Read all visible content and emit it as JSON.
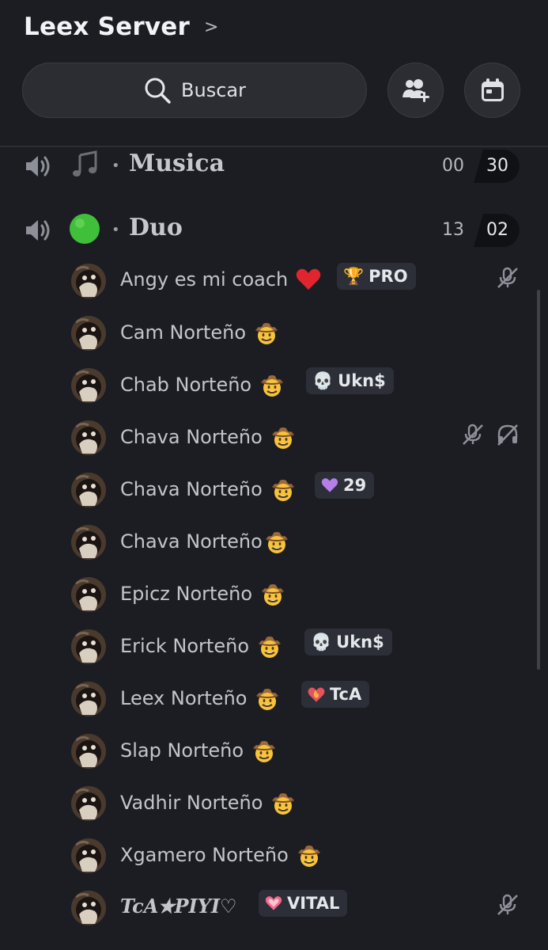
{
  "server": {
    "name": "Leex Server",
    "chevron": ">"
  },
  "search": {
    "label": "Buscar"
  },
  "channels": [
    {
      "emoji": "musical-note",
      "name": "Musica",
      "current": "00",
      "limit": "30"
    },
    {
      "emoji": "green-circle",
      "name": "Duo",
      "current": "13",
      "limit": "02"
    }
  ],
  "members": [
    {
      "name": "Angy es mi coach",
      "name_emoji": "red-heart",
      "tag": "PRO",
      "tag_icon": "trophy",
      "muted": true,
      "deafened": false
    },
    {
      "name": "Cam Norteño",
      "name_emoji": "cowboy-face",
      "tag": "",
      "muted": false,
      "deafened": false
    },
    {
      "name": "Chab Norteño",
      "name_emoji": "cowboy-face",
      "tag": "Ukn$",
      "tag_icon": "skull",
      "muted": false,
      "deafened": false
    },
    {
      "name": "Chava Norteño",
      "name_emoji": "cowboy-face",
      "tag": "",
      "muted": true,
      "deafened": true
    },
    {
      "name": "Chava Norteño",
      "name_emoji": "cowboy-face",
      "tag": "29",
      "tag_icon": "purple-heart",
      "muted": false,
      "deafened": false
    },
    {
      "name": "Chava Norteño",
      "name_emoji": "cowboy-face",
      "tag": "",
      "muted": false,
      "deafened": false
    },
    {
      "name": "Epicz Norteño",
      "name_emoji": "cowboy-face",
      "tag": "",
      "muted": false,
      "deafened": false
    },
    {
      "name": "Erick Norteño",
      "name_emoji": "cowboy-face",
      "tag": "Ukn$",
      "tag_icon": "skull",
      "muted": false,
      "deafened": false
    },
    {
      "name": "Leex Norteño",
      "name_emoji": "cowboy-face",
      "tag": "TcA",
      "tag_icon": "flame-heart",
      "muted": false,
      "deafened": false
    },
    {
      "name": "Slap Norteño",
      "name_emoji": "cowboy-face",
      "tag": "",
      "muted": false,
      "deafened": false
    },
    {
      "name": "Vadhir Norteño",
      "name_emoji": "cowboy-face",
      "tag": "",
      "muted": false,
      "deafened": false
    },
    {
      "name": "Xgamero Norteño",
      "name_emoji": "cowboy-face",
      "tag": "",
      "muted": false,
      "deafened": false
    },
    {
      "name": "TcA✭PIYI♡",
      "name_emoji": "",
      "tag": "VITAL",
      "tag_icon": "pink-heart",
      "muted": true,
      "deafened": false
    }
  ],
  "colors": {
    "background": "#1c1d22",
    "panel": "#2b2d33",
    "tag_bg": "#2c2f38",
    "text": "#c3c5cb"
  }
}
